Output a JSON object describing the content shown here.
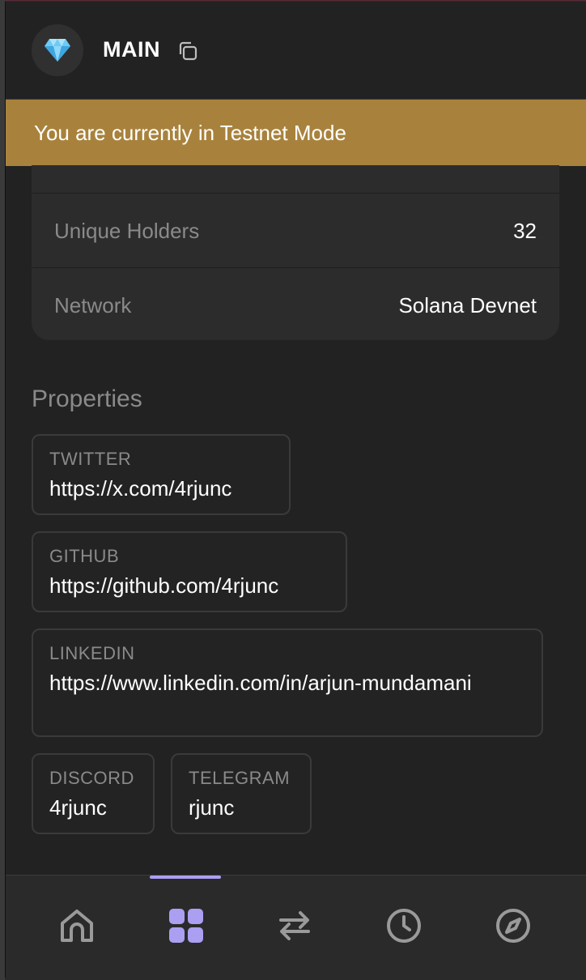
{
  "header": {
    "account_name": "MAIN",
    "avatar_icon": "gem-icon",
    "copy_icon": "copy-icon"
  },
  "banner": {
    "text": "You are currently in Testnet Mode",
    "color": "#a8823c"
  },
  "info": {
    "rows": [
      {
        "label": "Unique Holders",
        "value": "32"
      },
      {
        "label": "Network",
        "value": "Solana Devnet"
      }
    ]
  },
  "properties": {
    "title": "Properties",
    "items": [
      {
        "key": "TWITTER",
        "value": "https://x.com/4rjunc"
      },
      {
        "key": "GITHUB",
        "value": "https://github.com/4rjunc"
      },
      {
        "key": "LINKEDIN",
        "value": "https://www.linkedin.com/in/arjun-mundamani"
      },
      {
        "key": "DISCORD",
        "value": "4rjunc"
      },
      {
        "key": "TELEGRAM",
        "value": "rjunc"
      }
    ]
  },
  "nav": {
    "items": [
      {
        "icon": "home-icon"
      },
      {
        "icon": "collectibles-grid-icon",
        "active": true
      },
      {
        "icon": "swap-icon"
      },
      {
        "icon": "history-clock-icon"
      },
      {
        "icon": "explore-compass-icon"
      }
    ],
    "accent": "#ab9ff2"
  }
}
